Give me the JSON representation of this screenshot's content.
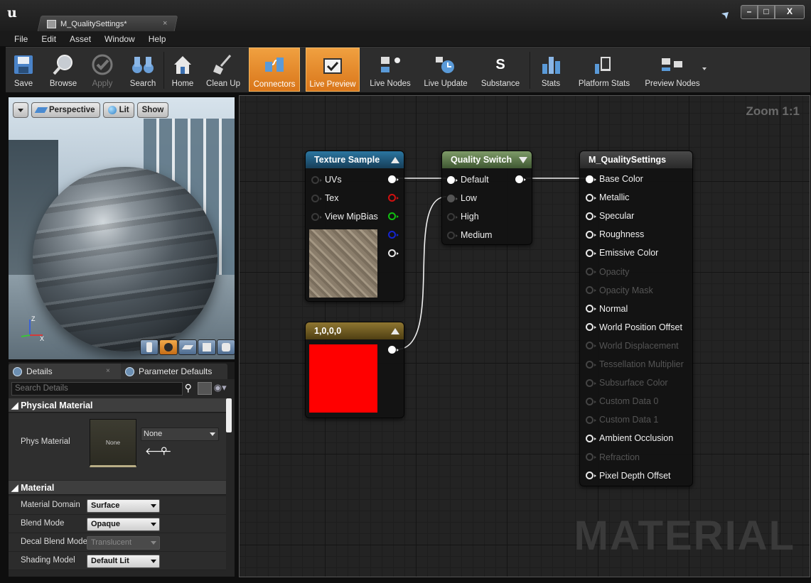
{
  "window": {
    "tab_title": "M_QualitySettings*",
    "tab_close": "×",
    "controls": {
      "minimize": "–",
      "maximize": "□",
      "close": "X"
    }
  },
  "menu": [
    "File",
    "Edit",
    "Asset",
    "Window",
    "Help"
  ],
  "toolbar": {
    "save": "Save",
    "browse": "Browse",
    "apply": "Apply",
    "search": "Search",
    "home": "Home",
    "clean_up": "Clean Up",
    "connectors": "Connectors",
    "live_preview": "Live Preview",
    "live_nodes": "Live Nodes",
    "live_update": "Live Update",
    "substance": "Substance",
    "substance_glyph": "S",
    "stats": "Stats",
    "platform_stats": "Platform Stats",
    "preview_nodes": "Preview Nodes",
    "accent_color": "#e8892a"
  },
  "viewport": {
    "perspective": "Perspective",
    "lit": "Lit",
    "show": "Show",
    "axis_z": "Z",
    "axis_x": "X"
  },
  "details": {
    "tab_details": "Details",
    "tab_params": "Parameter Defaults",
    "tab_close": "×",
    "search_placeholder": "Search Details",
    "physical_material_header": "◢ Physical Material",
    "phys_material_label": "Phys Material",
    "phys_thumb_text": "None",
    "phys_combo_value": "None",
    "material_header": "◢ Material",
    "properties": [
      {
        "label": "Material Domain",
        "value": "Surface",
        "enabled": true
      },
      {
        "label": "Blend Mode",
        "value": "Opaque",
        "enabled": true
      },
      {
        "label": "Decal Blend Mode",
        "value": "Translucent",
        "enabled": false
      },
      {
        "label": "Shading Model",
        "value": "Default Lit",
        "enabled": true
      }
    ]
  },
  "graph": {
    "zoom": "Zoom 1:1",
    "watermark": "MATERIAL",
    "texture_sample": {
      "title": "Texture Sample",
      "header_color": "#1f5b7e",
      "inputs": [
        "UVs",
        "Tex",
        "View MipBias"
      ]
    },
    "quality_switch": {
      "title": "Quality Switch",
      "header_color": "#57704a",
      "inputs": [
        "Default",
        "Low",
        "High",
        "Medium"
      ]
    },
    "constant": {
      "title": "1,0,0,0",
      "header_color": "#6f5a21",
      "swatch_color": "#ff0000"
    },
    "result": {
      "title": "M_QualitySettings",
      "header_color": "#3c3c3c",
      "inputs": [
        {
          "label": "Base Color",
          "enabled": true
        },
        {
          "label": "Metallic",
          "enabled": true
        },
        {
          "label": "Specular",
          "enabled": true
        },
        {
          "label": "Roughness",
          "enabled": true
        },
        {
          "label": "Emissive Color",
          "enabled": true
        },
        {
          "label": "Opacity",
          "enabled": false
        },
        {
          "label": "Opacity Mask",
          "enabled": false
        },
        {
          "label": "Normal",
          "enabled": true
        },
        {
          "label": "World Position Offset",
          "enabled": true
        },
        {
          "label": "World Displacement",
          "enabled": false
        },
        {
          "label": "Tessellation Multiplier",
          "enabled": false
        },
        {
          "label": "Subsurface Color",
          "enabled": false
        },
        {
          "label": "Custom Data 0",
          "enabled": false
        },
        {
          "label": "Custom Data 1",
          "enabled": false
        },
        {
          "label": "Ambient Occlusion",
          "enabled": true
        },
        {
          "label": "Refraction",
          "enabled": false
        },
        {
          "label": "Pixel Depth Offset",
          "enabled": true
        }
      ]
    }
  }
}
